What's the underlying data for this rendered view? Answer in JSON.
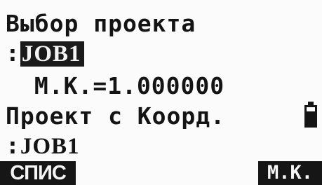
{
  "screen": {
    "title": "Выбор проекта",
    "job_prefix": ":",
    "job_selected": "JOB1",
    "scale_factor": " М.К.=1.000000",
    "coord_job_label": "Проект с Коорд.",
    "coord_job_prefix": ":",
    "coord_job_value": "JOB1",
    "battery_icon": "battery-icon"
  },
  "softkeys": {
    "f1": "СПИС",
    "f4": "М.К."
  }
}
